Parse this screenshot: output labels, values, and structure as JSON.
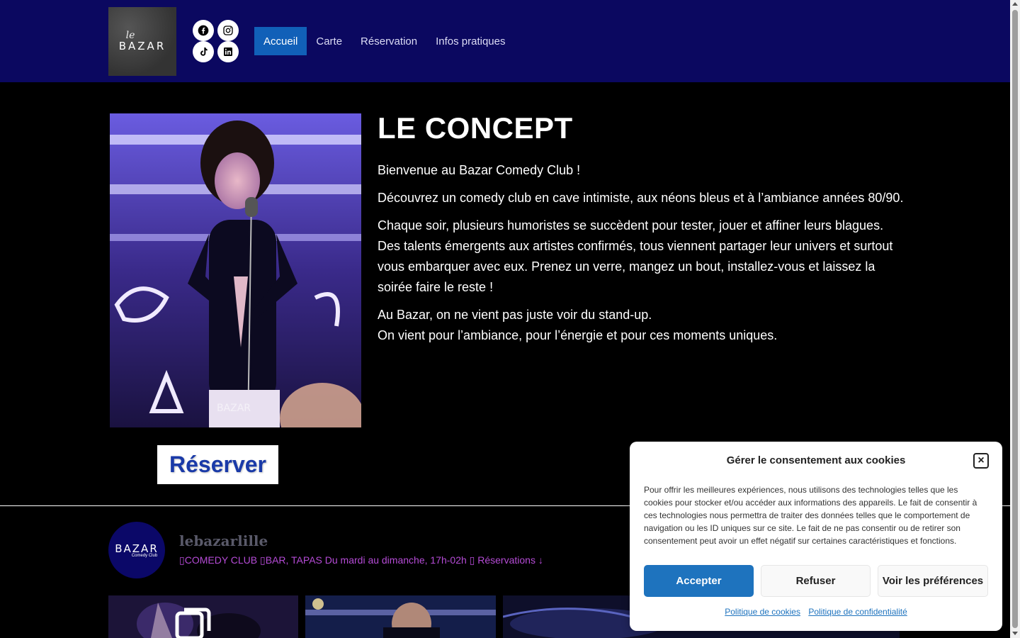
{
  "header": {
    "logo": {
      "le": "le",
      "bazar": "BAZAR"
    },
    "socials": [
      "facebook-icon",
      "instagram-icon",
      "tiktok-icon",
      "linkedin-icon"
    ],
    "nav": [
      {
        "label": "Accueil",
        "active": true
      },
      {
        "label": "Carte",
        "active": false
      },
      {
        "label": "Réservation",
        "active": false
      },
      {
        "label": "Infos pratiques",
        "active": false
      }
    ]
  },
  "concept": {
    "title": "LE CONCEPT",
    "p1": "Bienvenue au Bazar Comedy Club !",
    "p2": "Découvrez un comedy club en cave intimiste, aux néons bleus et à l’ambiance années 80/90.",
    "p3": "Chaque soir, plusieurs humoristes se succèdent pour tester, jouer et affiner leurs blagues. Des talents émergents aux artistes confirmés, tous viennent partager leur univers et surtout vous embarquer avec eux. Prenez un verre, mangez un bout, installez-vous et laissez la soirée faire le reste !",
    "p4a": "Au Bazar, on ne vient pas juste voir du stand-up.",
    "p4b": "On vient pour l’ambiance, pour l’énergie et pour ces moments uniques.",
    "photo_watermark": "BAZAR",
    "reserve_label": "Réserver"
  },
  "instagram": {
    "avatar_text": "BAZAR",
    "avatar_sub": "Comedy Club",
    "handle": "lebazarlille",
    "bio": "▯COMEDY CLUB ▯BAR, TAPAS Du mardi au dimanche, 17h-02h ▯ Réservations ↓"
  },
  "cookie": {
    "title": "Gérer le consentement aux cookies",
    "text": "Pour offrir les meilleures expériences, nous utilisons des technologies telles que les cookies pour stocker et/ou accéder aux informations des appareils. Le fait de consentir à ces technologies nous permettra de traiter des données telles que le comportement de navigation ou les ID uniques sur ce site. Le fait de ne pas consentir ou de retirer son consentement peut avoir un effet négatif sur certaines caractéristiques et fonctions.",
    "accept": "Accepter",
    "refuse": "Refuser",
    "prefs": "Voir les préférences",
    "link_cookies": "Politique de cookies",
    "link_privacy": "Politique de confidentialité",
    "close_icon": "close-icon"
  },
  "colors": {
    "header_bg": "#0b0860",
    "nav_active": "#1160b8",
    "accept_btn": "#1e73be",
    "reserve_text": "#1a3aa8"
  }
}
